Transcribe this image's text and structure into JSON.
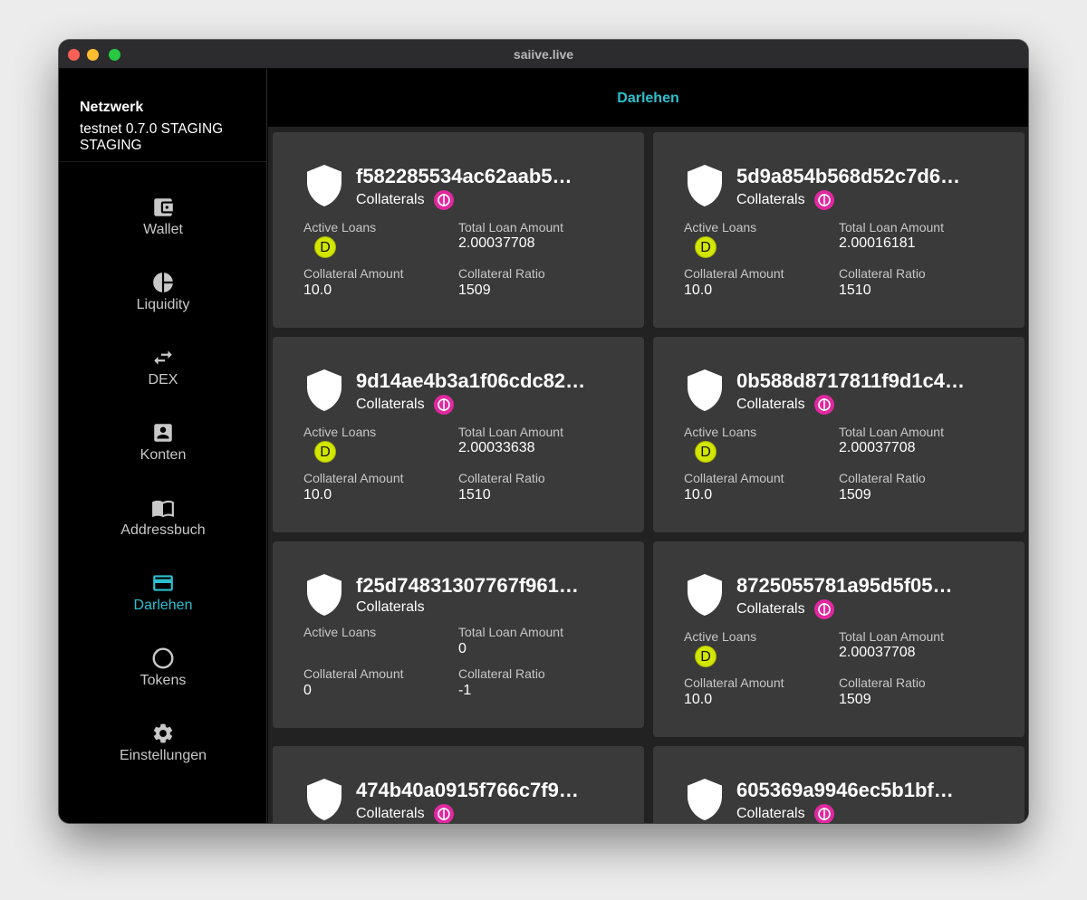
{
  "window": {
    "title": "saiive.live"
  },
  "sidebar": {
    "network_label": "Netzwerk",
    "network_info": "testnet   0.7.0   STAGING STAGING",
    "items": [
      {
        "label": "Wallet",
        "icon": "wallet-icon"
      },
      {
        "label": "Liquidity",
        "icon": "pie-chart-icon"
      },
      {
        "label": "DEX",
        "icon": "swap-arrows-icon"
      },
      {
        "label": "Konten",
        "icon": "account-box-icon"
      },
      {
        "label": "Addressbuch",
        "icon": "book-icon"
      },
      {
        "label": "Darlehen",
        "icon": "credit-card-icon",
        "active": true
      },
      {
        "label": "Tokens",
        "icon": "circle-icon"
      },
      {
        "label": "Einstellungen",
        "icon": "gear-icon"
      }
    ]
  },
  "page": {
    "title": "Darlehen"
  },
  "labels": {
    "collaterals": "Collaterals",
    "active_loans": "Active Loans",
    "total_loan_amount": "Total Loan Amount",
    "collateral_amount": "Collateral Amount",
    "collateral_ratio": "Collateral Ratio"
  },
  "colors": {
    "accent": "#2cc0cf",
    "dfi_badge": "#e0289f",
    "dusd_badge": "#d2e600"
  },
  "vaults": [
    {
      "id": "f582285534ac62aab5…",
      "has_collateral": true,
      "loan_token": "D",
      "total_loan_amount": "2.00037708",
      "collateral_amount": "10.0",
      "collateral_ratio": "1509"
    },
    {
      "id": "5d9a854b568d52c7d6…",
      "has_collateral": true,
      "loan_token": "D",
      "total_loan_amount": "2.00016181",
      "collateral_amount": "10.0",
      "collateral_ratio": "1510"
    },
    {
      "id": "9d14ae4b3a1f06cdc82…",
      "has_collateral": true,
      "loan_token": "D",
      "total_loan_amount": "2.00033638",
      "collateral_amount": "10.0",
      "collateral_ratio": "1510"
    },
    {
      "id": "0b588d8717811f9d1c4…",
      "has_collateral": true,
      "loan_token": "D",
      "total_loan_amount": "2.00037708",
      "collateral_amount": "10.0",
      "collateral_ratio": "1509"
    },
    {
      "id": "f25d74831307767f961…",
      "has_collateral": false,
      "loan_token": "",
      "total_loan_amount": "0",
      "collateral_amount": "0",
      "collateral_ratio": "-1"
    },
    {
      "id": "8725055781a95d5f05…",
      "has_collateral": true,
      "loan_token": "D",
      "total_loan_amount": "2.00037708",
      "collateral_amount": "10.0",
      "collateral_ratio": "1509"
    },
    {
      "id": "474b40a0915f766c7f9…",
      "has_collateral": true
    },
    {
      "id": "605369a9946ec5b1bf…",
      "has_collateral": true
    }
  ]
}
